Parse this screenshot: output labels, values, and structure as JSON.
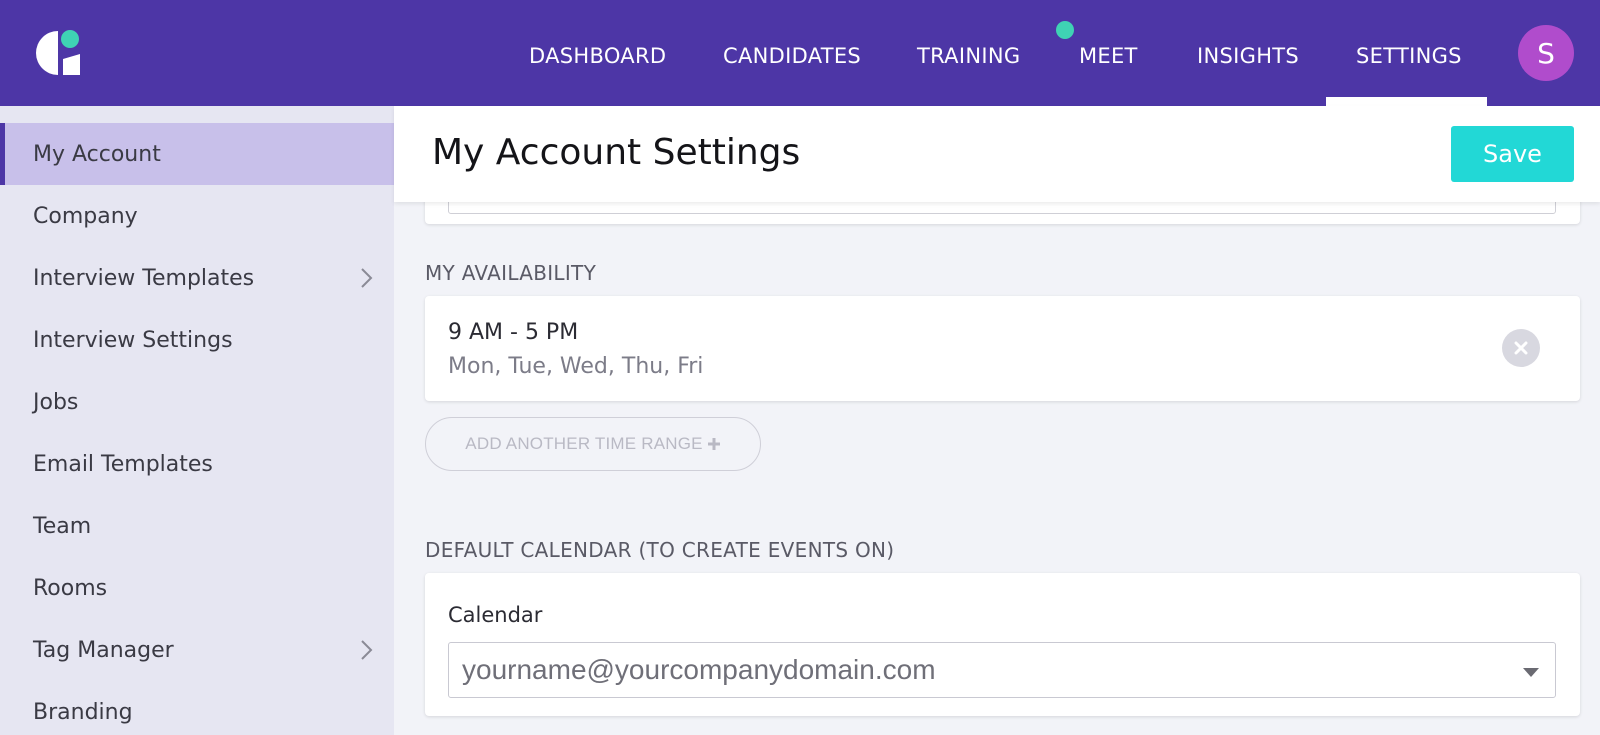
{
  "nav": {
    "items": [
      {
        "id": "dashboard",
        "label": "DASHBOARD"
      },
      {
        "id": "candidates",
        "label": "CANDIDATES"
      },
      {
        "id": "training",
        "label": "TRAINING"
      },
      {
        "id": "meet",
        "label": "MEET"
      },
      {
        "id": "insights",
        "label": "INSIGHTS"
      },
      {
        "id": "settings",
        "label": "SETTINGS"
      }
    ],
    "active": "SETTINGS",
    "avatar_initial": "S",
    "brand_color": "#4d36a6",
    "notification_dot_color": "#3fd2b4"
  },
  "sidebar": {
    "items": [
      {
        "label": "My Account",
        "active": true,
        "has_submenu": false
      },
      {
        "label": "Company",
        "active": false,
        "has_submenu": false
      },
      {
        "label": "Interview Templates",
        "active": false,
        "has_submenu": true
      },
      {
        "label": "Interview Settings",
        "active": false,
        "has_submenu": false
      },
      {
        "label": "Jobs",
        "active": false,
        "has_submenu": false
      },
      {
        "label": "Email Templates",
        "active": false,
        "has_submenu": false
      },
      {
        "label": "Team",
        "active": false,
        "has_submenu": false
      },
      {
        "label": "Rooms",
        "active": false,
        "has_submenu": false
      },
      {
        "label": "Tag Manager",
        "active": false,
        "has_submenu": true
      },
      {
        "label": "Branding",
        "active": false,
        "has_submenu": false
      }
    ]
  },
  "header": {
    "title": "My Account Settings",
    "save_label": "Save",
    "save_color": "#22d8d6"
  },
  "availability": {
    "section_label": "MY AVAILABILITY",
    "ranges": [
      {
        "time": "9 AM - 5 PM",
        "days": "Mon, Tue, Wed, Thu, Fri"
      }
    ],
    "add_label": "ADD ANOTHER TIME RANGE"
  },
  "calendar": {
    "section_label": "DEFAULT CALENDAR (TO CREATE EVENTS ON)",
    "field_label": "Calendar",
    "selected_value": "yourname@yourcompanydomain.com"
  }
}
